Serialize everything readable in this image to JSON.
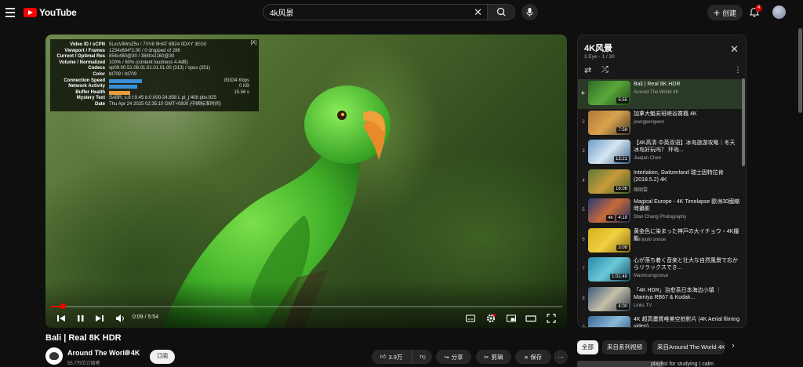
{
  "header": {
    "logo_text": "YouTube",
    "search": {
      "value": "4k风景",
      "placeholder": ""
    },
    "create_label": "创建",
    "notifications_count": "4"
  },
  "player": {
    "stats": [
      {
        "key": "Video ID / sCPN",
        "value": "5LxsViMmZ5o / 7VV8 9HAT 6B24 0DXY 3EG0"
      },
      {
        "key": "Viewport / Frames",
        "value": "1234x694*2.00 / 0 dropped of 286"
      },
      {
        "key": "Current / Optimal Res",
        "value": "854x480@30 / 3840x2160@30"
      },
      {
        "key": "Volume / Normalized",
        "value": "100% / 60% (content loudness 4.4dB)"
      },
      {
        "key": "Codecs",
        "value": "vp09.00.51.08.01.01.01.01.00 (313) / opus (251)"
      },
      {
        "key": "Color",
        "value": "bt709 / bt709"
      },
      {
        "key": "Connection Speed",
        "value": "",
        "right": "83334 Kbps",
        "bar": "#3a8fd9",
        "bar_fraction": 0.7
      },
      {
        "key": "Network Activity",
        "value": "",
        "right": "0 KB",
        "bar": "#3a8fd9",
        "bar_fraction": 0.6
      },
      {
        "key": "Buffer Health",
        "value": "",
        "right": "15.56 s",
        "bar": "#e89b3c",
        "bar_fraction": 0.45
      },
      {
        "key": "Mystery Text",
        "value": "SABR, s:8 t:9.45 b:0.000-24.858 L pl_j:408 pbs:925"
      },
      {
        "key": "Date",
        "value": "Thu Apr 24 2025 02:35:10 GMT+0800 (中国标准时间)"
      }
    ],
    "stats_close": "[X]",
    "time_display": "0:09 / 5:54",
    "progress_fraction": 0.025,
    "accent_color": "#ff0000"
  },
  "playlist": {
    "title": "4K风景",
    "subtitle": "3 Eye - 1 / 30",
    "items": [
      {
        "index": "▶",
        "title": "Bali | Real 8K HDR",
        "channel": "Around The World 4K",
        "duration": "5:55",
        "badge": "",
        "active": true,
        "thumb": "linear-gradient(135deg,#2f6b2a,#5aa83a,#1e4a1a)"
      },
      {
        "index": "2",
        "title": "加拿大魁安班峡谷賞楓 4K",
        "channel": "jeangpengwen",
        "duration": "7:59",
        "badge": "",
        "active": false,
        "thumb": "linear-gradient(135deg,#b07a3a,#d8a24e,#4a3a2a)"
      },
      {
        "index": "3",
        "title": "【4K高清 中英双语】冰岛旅游攻略｜冬天冰岛好玩吗？ 环岛...",
        "channel": "Jiaqian Chen",
        "duration": "13:21",
        "badge": "",
        "active": false,
        "thumb": "linear-gradient(135deg,#6a9cc8,#d6e6f2,#3a5f88)"
      },
      {
        "index": "4",
        "title": "Interlaken, Switzerland 瑞士因特拉肯(2018.5.2) 4K",
        "channel": "陳朗雲",
        "duration": "16:06",
        "badge": "",
        "active": false,
        "thumb": "linear-gradient(135deg,#5a7a3a,#c89a3a,#3a5a2a)"
      },
      {
        "index": "5",
        "title": "Magical Europe - 4K Timelapse 歐洲30國縮時攝影",
        "channel": "Stan Chang Photography",
        "duration": "4:19",
        "badge": "4K",
        "active": false,
        "thumb": "linear-gradient(135deg,#2a3a7a,#c86a3a,#1a2a5a)"
      },
      {
        "index": "6",
        "title": "黄金色に染まった神戸の大イチョウ・4K撮影",
        "channel": "haruyuki onoue",
        "duration": "3:08",
        "badge": "",
        "active": false,
        "thumb": "linear-gradient(135deg,#d8b020,#f0d040,#8a6a10)"
      },
      {
        "index": "7",
        "title": "心が落ち着く音楽と壮大な自然風景で忘からリラックスでき...",
        "channel": "Maximumgroove",
        "duration": "1:01:49",
        "badge": "",
        "active": false,
        "thumb": "linear-gradient(135deg,#2a8aa8,#6ac8d8,#1a4a5a)"
      },
      {
        "index": "8",
        "title": "「4K HDR」治愈系日本海边小镇 ｜ Mamiya RB67 & Kodak...",
        "channel": "Links TV",
        "duration": "4:00",
        "badge": "",
        "active": false,
        "thumb": "linear-gradient(135deg,#3a5a7a,#c8c0a8,#2a3a4a)"
      },
      {
        "index": "9",
        "title": "4K 超高畫質唯美空拍影片 (4K Aerial filming video)",
        "channel": "",
        "duration": "",
        "badge": "",
        "active": false,
        "thumb": "linear-gradient(135deg,#3a6a9a,#8ab8d8,#2a4a6a)"
      }
    ]
  },
  "video": {
    "title": "Bali | Real 8K HDR",
    "channel": "Around The World 4K",
    "subscribers": "55.7万位订阅者",
    "subscribe_label": "订阅",
    "likes": "3.9万",
    "share_label": "分享",
    "clip_label": "剪辑",
    "save_label": "保存"
  },
  "chips": [
    "全部",
    "来自系列视频",
    "来自Around The World 4K"
  ],
  "recommendation_peek": "playlist for studying | calm"
}
